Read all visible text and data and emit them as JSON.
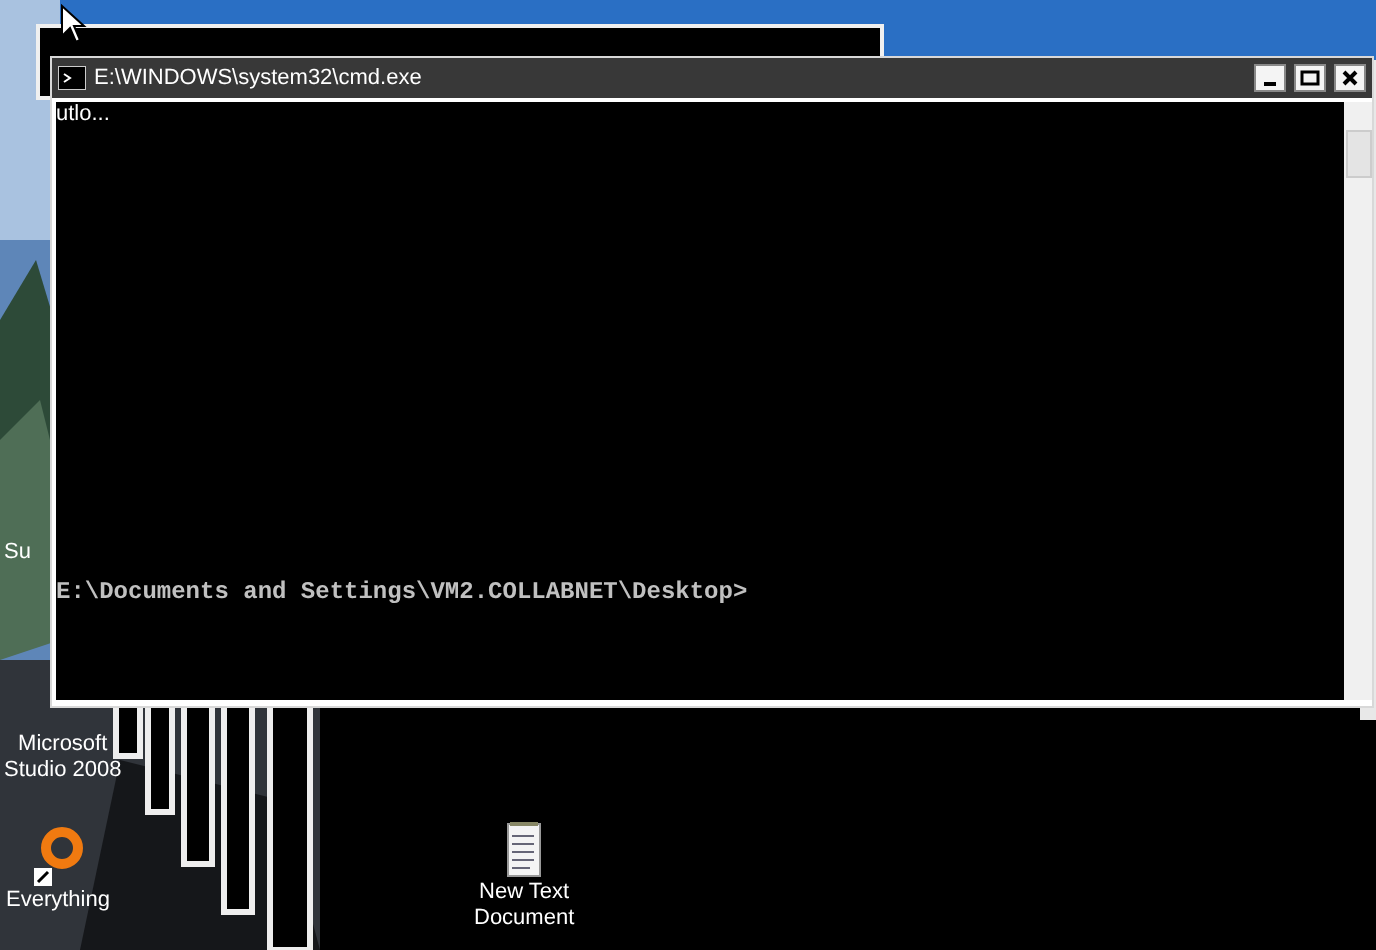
{
  "desktop_icons": [
    {
      "label": "utlo...",
      "kind": "overlay"
    },
    {
      "label": "Su",
      "kind": "partial"
    },
    {
      "label": "Microsoft\nStudio 2008",
      "kind": "partial"
    },
    {
      "label": "Everything",
      "kind": "ring"
    },
    {
      "label": "New Text\nDocument",
      "kind": "notepad"
    }
  ],
  "window": {
    "title": "E:\\WINDOWS\\system32\\cmd.exe",
    "lines": [
      "E:\\Documents and Settings\\VM2.COLLABNET\\Desktop>"
    ]
  }
}
